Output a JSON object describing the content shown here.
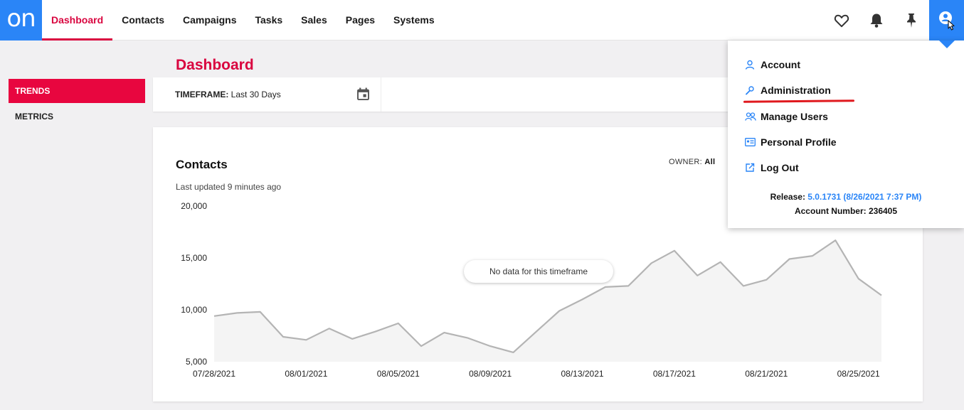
{
  "app": {
    "logo_text": "on"
  },
  "nav": {
    "items": [
      {
        "label": "Dashboard",
        "active": true
      },
      {
        "label": "Contacts"
      },
      {
        "label": "Campaigns"
      },
      {
        "label": "Tasks"
      },
      {
        "label": "Sales"
      },
      {
        "label": "Pages"
      },
      {
        "label": "Systems"
      }
    ],
    "icons": [
      "heart-icon",
      "bell-icon",
      "pin-icon",
      "user-icon"
    ]
  },
  "sidebar": {
    "items": [
      {
        "label": "TRENDS",
        "active": true
      },
      {
        "label": "METRICS"
      }
    ]
  },
  "page": {
    "title": "Dashboard"
  },
  "timeframe": {
    "label": "TIMEFRAME:",
    "value": "Last 30 Days"
  },
  "card": {
    "title": "Contacts",
    "updated": "Last updated 9 minutes ago",
    "owner_label": "OWNER:",
    "owner_value": "All",
    "no_data": "No data for this timeframe"
  },
  "dropdown": {
    "items": [
      {
        "label": "Account",
        "icon": "person-icon"
      },
      {
        "label": "Administration",
        "icon": "wrench-icon"
      },
      {
        "label": "Manage Users",
        "icon": "users-icon"
      },
      {
        "label": "Personal Profile",
        "icon": "id-card-icon"
      },
      {
        "label": "Log Out",
        "icon": "external-link-icon"
      }
    ],
    "release_label": "Release:",
    "release_value": "5.0.1731 (8/26/2021 7:37 PM)",
    "account_label": "Account Number:",
    "account_value": "236405"
  },
  "colors": {
    "brand_blue": "#2a85f7",
    "accent_red": "#d9053f",
    "line_gray": "#b4b4b4"
  },
  "chart_data": {
    "type": "area",
    "ylim": [
      5000,
      20000
    ],
    "y_ticks": [
      "20,000",
      "15,000",
      "10,000",
      "5,000"
    ],
    "y_tick_values": [
      20000,
      15000,
      10000,
      5000
    ],
    "x_ticks": [
      "07/28/2021",
      "08/01/2021",
      "08/05/2021",
      "08/09/2021",
      "08/13/2021",
      "08/17/2021",
      "08/21/2021",
      "08/25/2021"
    ],
    "x": [
      "07/28/2021",
      "07/29/2021",
      "07/30/2021",
      "07/31/2021",
      "08/01/2021",
      "08/02/2021",
      "08/03/2021",
      "08/04/2021",
      "08/05/2021",
      "08/06/2021",
      "08/07/2021",
      "08/08/2021",
      "08/09/2021",
      "08/10/2021",
      "08/11/2021",
      "08/12/2021",
      "08/13/2021",
      "08/14/2021",
      "08/15/2021",
      "08/16/2021",
      "08/17/2021",
      "08/18/2021",
      "08/19/2021",
      "08/20/2021",
      "08/21/2021",
      "08/22/2021",
      "08/23/2021",
      "08/24/2021",
      "08/25/2021",
      "08/26/2021"
    ],
    "values": [
      9400,
      9700,
      9800,
      7400,
      7100,
      8200,
      7200,
      7900,
      8700,
      6500,
      7800,
      7300,
      6500,
      5900,
      7900,
      9900,
      11000,
      12200,
      12300,
      14500,
      15700,
      13300,
      14600,
      12300,
      12900,
      14900,
      15200,
      16700,
      13000,
      11400
    ]
  }
}
